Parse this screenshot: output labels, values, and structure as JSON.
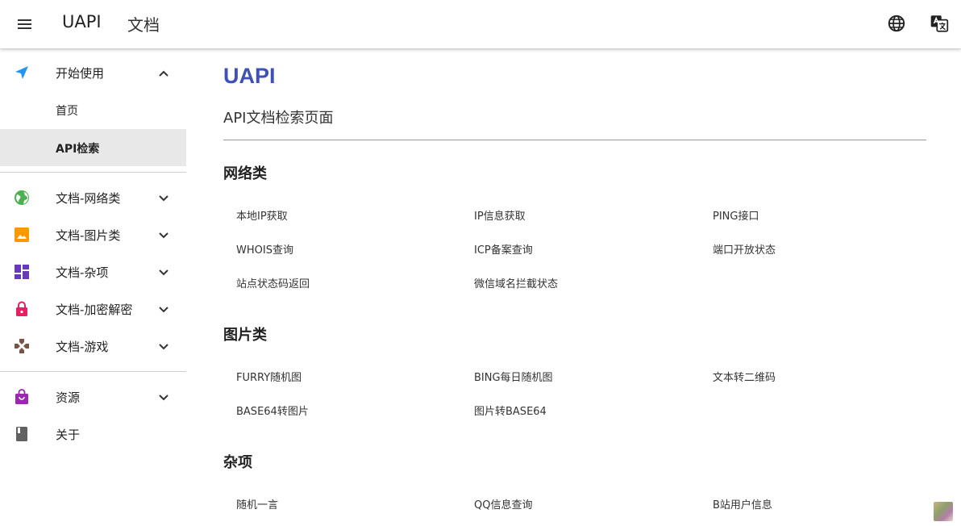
{
  "header": {
    "brand": "UAPI",
    "docs_label": "文档",
    "icons": [
      "menu-icon",
      "globe-icon",
      "translate-icon"
    ]
  },
  "sidebar": {
    "items": [
      {
        "label": "开始使用",
        "icon": "send-icon",
        "color": "#2196f3",
        "expanded": true
      },
      {
        "label": "文档-网络类",
        "icon": "earth-icon",
        "color": "#4caf50"
      },
      {
        "label": "文档-图片类",
        "icon": "image-icon",
        "color": "#ff9800"
      },
      {
        "label": "文档-杂项",
        "icon": "dashboard-icon",
        "color": "#673ab7"
      },
      {
        "label": "文档-加密解密",
        "icon": "lock-icon",
        "color": "#e91e63"
      },
      {
        "label": "文档-游戏",
        "icon": "gamepad-icon",
        "color": "#795548"
      },
      {
        "label": "资源",
        "icon": "shopping-bag-icon",
        "color": "#9c27b0"
      },
      {
        "label": "关于",
        "icon": "book-icon",
        "color": "#616161"
      }
    ],
    "sub_items": [
      {
        "label": "首页",
        "active": false
      },
      {
        "label": "API检索",
        "active": true
      }
    ]
  },
  "main": {
    "title": "UAPI",
    "subtitle": "API文档检索页面",
    "title_color": "#3f51b5",
    "sections": [
      {
        "title": "网络类",
        "links": [
          "本地IP获取",
          "IP信息获取",
          "PING接口",
          "WHOIS查询",
          "ICP备案查询",
          "端口开放状态",
          "站点状态码返回",
          "微信域名拦截状态"
        ]
      },
      {
        "title": "图片类",
        "links": [
          "FURRY随机图",
          "BING每日随机图",
          "文本转二维码",
          "BASE64转图片",
          "图片转BASE64"
        ]
      },
      {
        "title": "杂项",
        "links": [
          "随机一言",
          "QQ信息查询",
          "B站用户信息"
        ]
      }
    ]
  }
}
